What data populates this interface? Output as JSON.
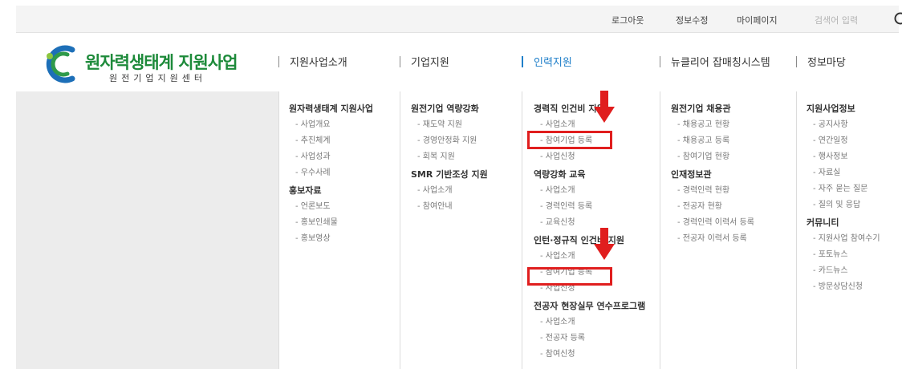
{
  "topbar": {
    "logout": "로그아웃",
    "edit_info": "정보수정",
    "mypage": "마이페이지",
    "search_placeholder": "검색어 입력",
    "search_icon": "search-icon"
  },
  "logo": {
    "title": "원자력생태계 지원사업",
    "subtitle": "원전기업지원센터"
  },
  "nav": [
    {
      "label": "지원사업소개",
      "active": false
    },
    {
      "label": "기업지원",
      "active": false
    },
    {
      "label": "인력지원",
      "active": true
    },
    {
      "label": "뉴클리어 잡매칭시스템",
      "active": false
    },
    {
      "label": "정보마당",
      "active": false
    }
  ],
  "columns": [
    {
      "groups": [
        {
          "title": "원자력생태계 지원사업",
          "items": [
            "- 사업개요",
            "- 추진체계",
            "- 사업성과",
            "- 우수사례"
          ]
        },
        {
          "title": "홍보자료",
          "items": [
            "- 언론보도",
            "- 홍보인쇄물",
            "- 홍보영상"
          ]
        }
      ]
    },
    {
      "groups": [
        {
          "title": "원전기업 역량강화",
          "items": [
            "- 재도약 지원",
            "- 경영안정화 지원",
            "- 회복 지원"
          ]
        },
        {
          "title": "SMR 기반조성 지원",
          "items": [
            "- 사업소개",
            "- 참여안내"
          ]
        }
      ]
    },
    {
      "groups": [
        {
          "title": "경력직 인건비 지원",
          "items": [
            "- 사업소개",
            "- 참여기업 등록",
            "- 사업신청"
          ]
        },
        {
          "title": "역량강화 교육",
          "items": [
            "- 사업소개",
            "- 경력인력 등록",
            "- 교육신청"
          ]
        },
        {
          "title": "인턴·정규직 인건비 지원",
          "items": [
            "- 사업소개",
            "- 참여기업 등록",
            "- 사업신청"
          ]
        },
        {
          "title": "전공자 현장실무 연수프로그램",
          "items": [
            "- 사업소개",
            "- 전공자 등록",
            "- 참여신청"
          ]
        }
      ]
    },
    {
      "groups": [
        {
          "title": "원전기업 채용관",
          "items": [
            "- 채용공고 현황",
            "- 채용공고 등록",
            "- 참여기업 현황"
          ]
        },
        {
          "title": "인재정보관",
          "items": [
            "- 경력인력 현황",
            "- 전공자 현황",
            "- 경력인력 이력서 등록",
            "- 전공자 이력서 등록"
          ]
        }
      ]
    },
    {
      "groups": [
        {
          "title": "지원사업정보",
          "items": [
            "- 공지사항",
            "- 연간일정",
            "- 행사정보",
            "- 자료실",
            "- 자주 묻는 질문",
            "- 질의 및 응답"
          ]
        },
        {
          "title": "커뮤니티",
          "items": [
            "- 지원사업 참여수기",
            "- 포토뉴스",
            "- 카드뉴스",
            "- 방문상담신청"
          ]
        }
      ]
    }
  ],
  "colors": {
    "accent": "#1f7fc9",
    "logo_green": "#1d8a3a",
    "annotation_red": "#e01e1e"
  }
}
